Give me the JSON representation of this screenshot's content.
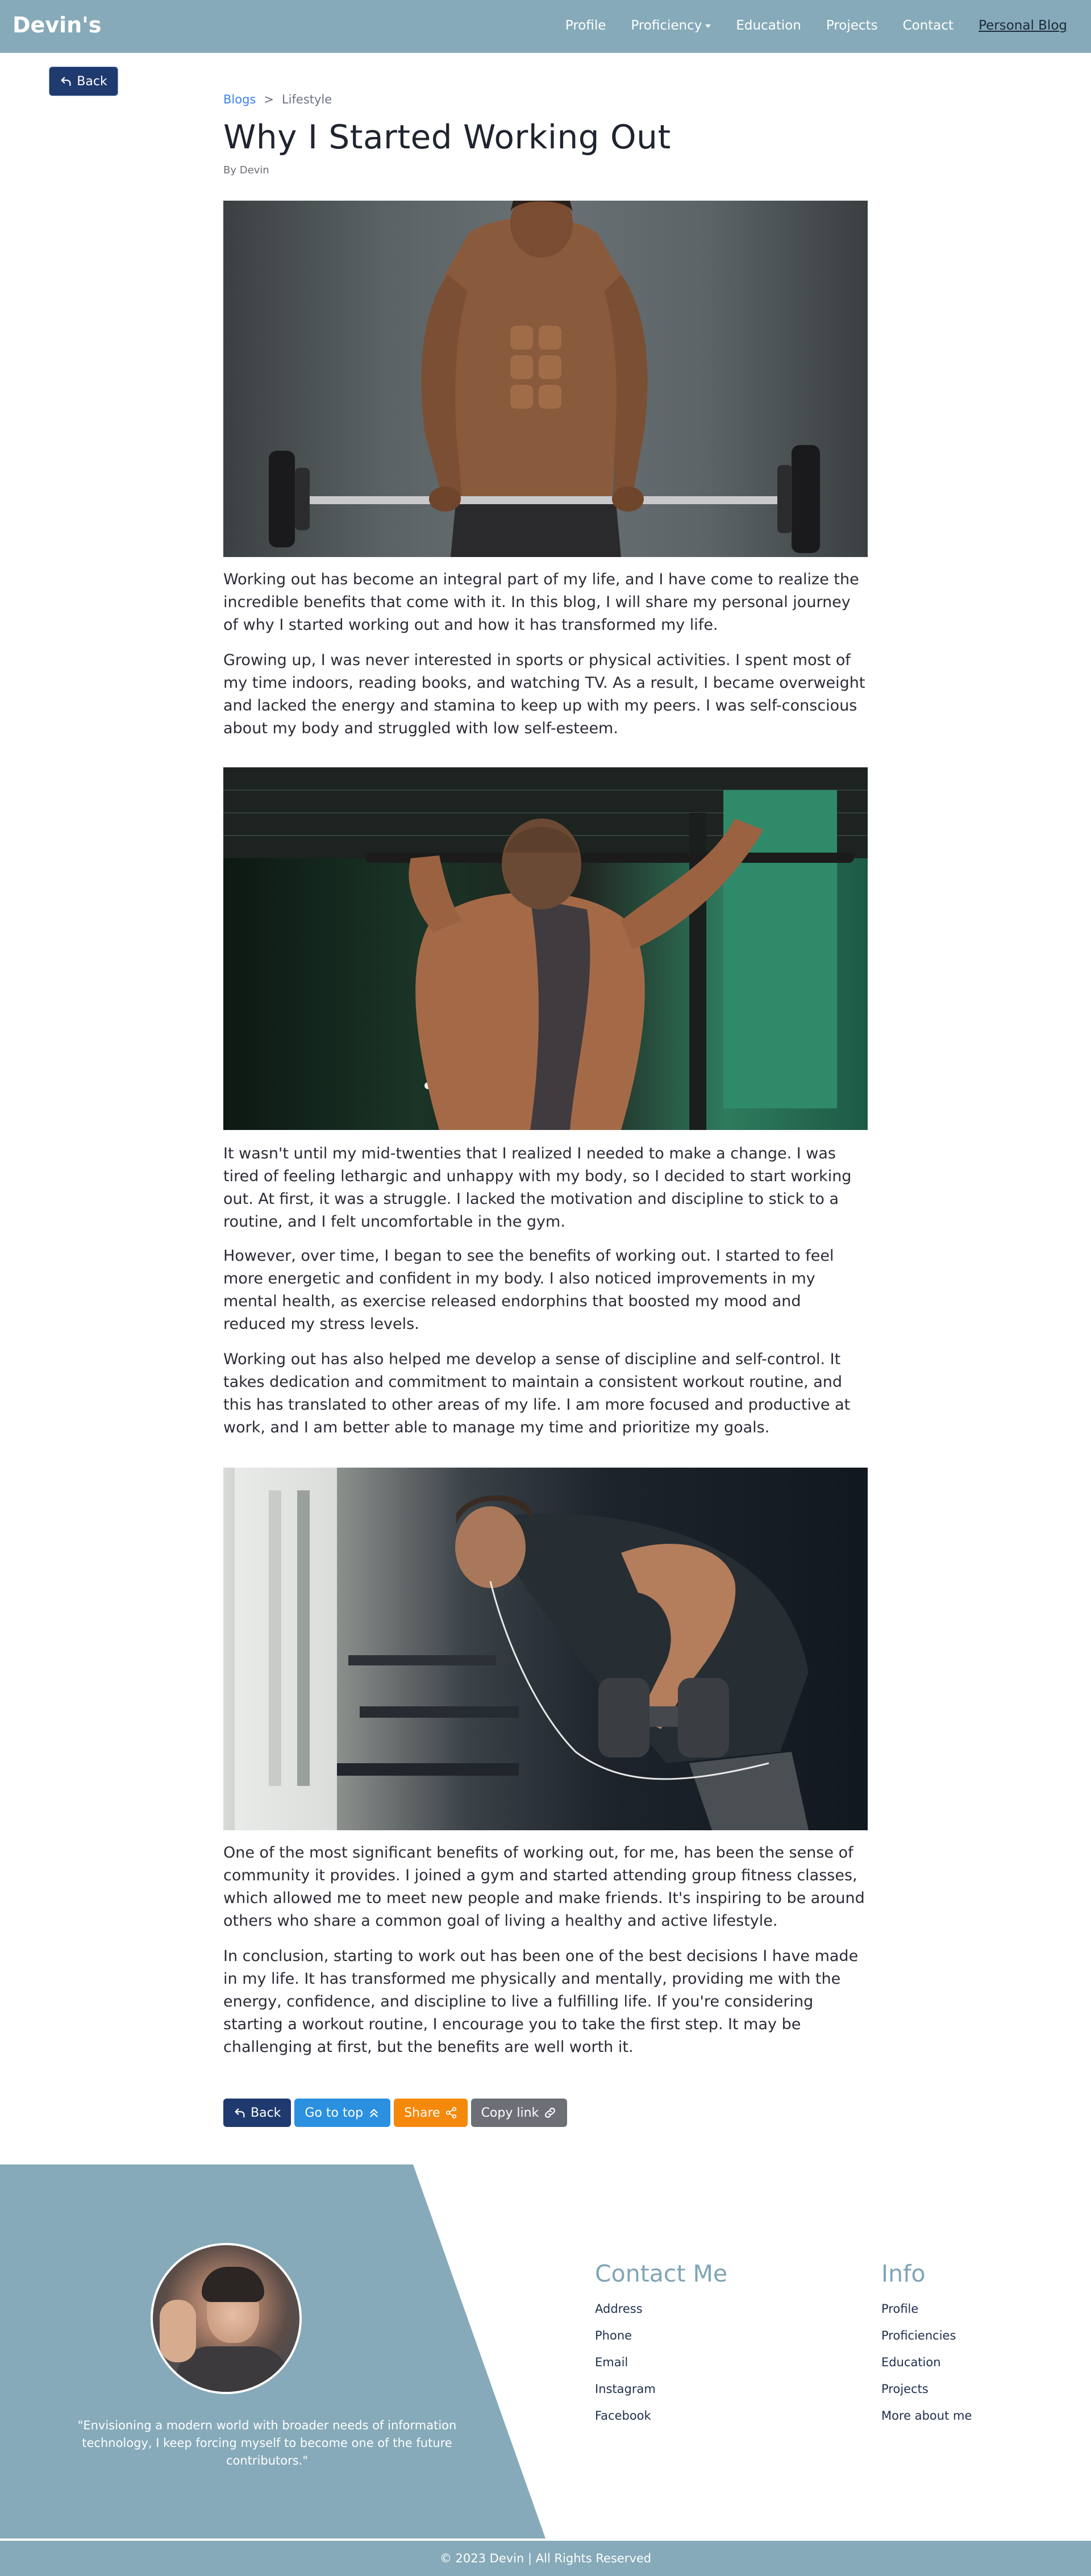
{
  "navbar": {
    "brand": "Devin's",
    "links": [
      {
        "label": "Profile"
      },
      {
        "label": "Proficiency"
      },
      {
        "label": "Education"
      },
      {
        "label": "Projects"
      },
      {
        "label": "Contact"
      },
      {
        "label": "Personal Blog"
      }
    ],
    "color": "#86aab9"
  },
  "back_button": {
    "label": "Back",
    "icon": "back-arrow-icon"
  },
  "breadcrumb": {
    "root": "Blogs",
    "separator": ">",
    "current": "Lifestyle"
  },
  "article": {
    "title": "Why I Started Working Out",
    "author": "By Devin",
    "paragraphs": [
      "Working out has become an integral part of my life, and I have come to realize the incredible benefits that come with it. In this blog, I will share my personal journey of why I started working out and how it has transformed my life.",
      "Growing up, I was never interested in sports or physical activities. I spent most of my time indoors, reading books, and watching TV. As a result, I became overweight and lacked the energy and stamina to keep up with my peers. I was self-conscious about my body and struggled with low self-esteem.",
      "It wasn't until my mid-twenties that I realized I needed to make a change. I was tired of feeling lethargic and unhappy with my body, so I decided to start working out. At first, it was a struggle. I lacked the motivation and discipline to stick to a routine, and I felt uncomfortable in the gym.",
      "However, over time, I began to see the benefits of working out. I started to feel more energetic and confident in my body. I also noticed improvements in my mental health, as exercise released endorphins that boosted my mood and reduced my stress levels.",
      "Working out has also helped me develop a sense of discipline and self-control. It takes dedication and commitment to maintain a consistent workout routine, and this has translated to other areas of my life. I am more focused and productive at work, and I am better able to manage my time and prioritize my goals.",
      "One of the most significant benefits of working out, for me, has been the sense of community it provides. I joined a gym and started attending group fitness classes, which allowed me to meet new people and make friends. It's inspiring to be around others who share a common goal of living a healthy and active lifestyle.",
      "In conclusion, starting to work out has been one of the best decisions I have made in my life. It has transformed me physically and mentally, providing me with the energy, confidence, and discipline to live a fulfilling life. If you're considering starting a workout routine, I encourage you to take the first step. It may be challenging at first, but the benefits are well worth it."
    ]
  },
  "actions": {
    "back": "Back",
    "top": "Go to top",
    "share": "Share",
    "copy": "Copy link"
  },
  "footer": {
    "quote": "\"Envisioning a modern world with broader needs of information technology, I keep forcing myself to become one of the future contributors.\"",
    "contact": {
      "title": "Contact Me",
      "links": [
        "Address",
        "Phone",
        "Email",
        "Instagram",
        "Facebook"
      ]
    },
    "info": {
      "title": "Info",
      "links": [
        "Profile",
        "Proficiencies",
        "Education",
        "Projects",
        "More about me"
      ]
    },
    "copyright": "© 2023 Devin | All Rights Reserved"
  }
}
